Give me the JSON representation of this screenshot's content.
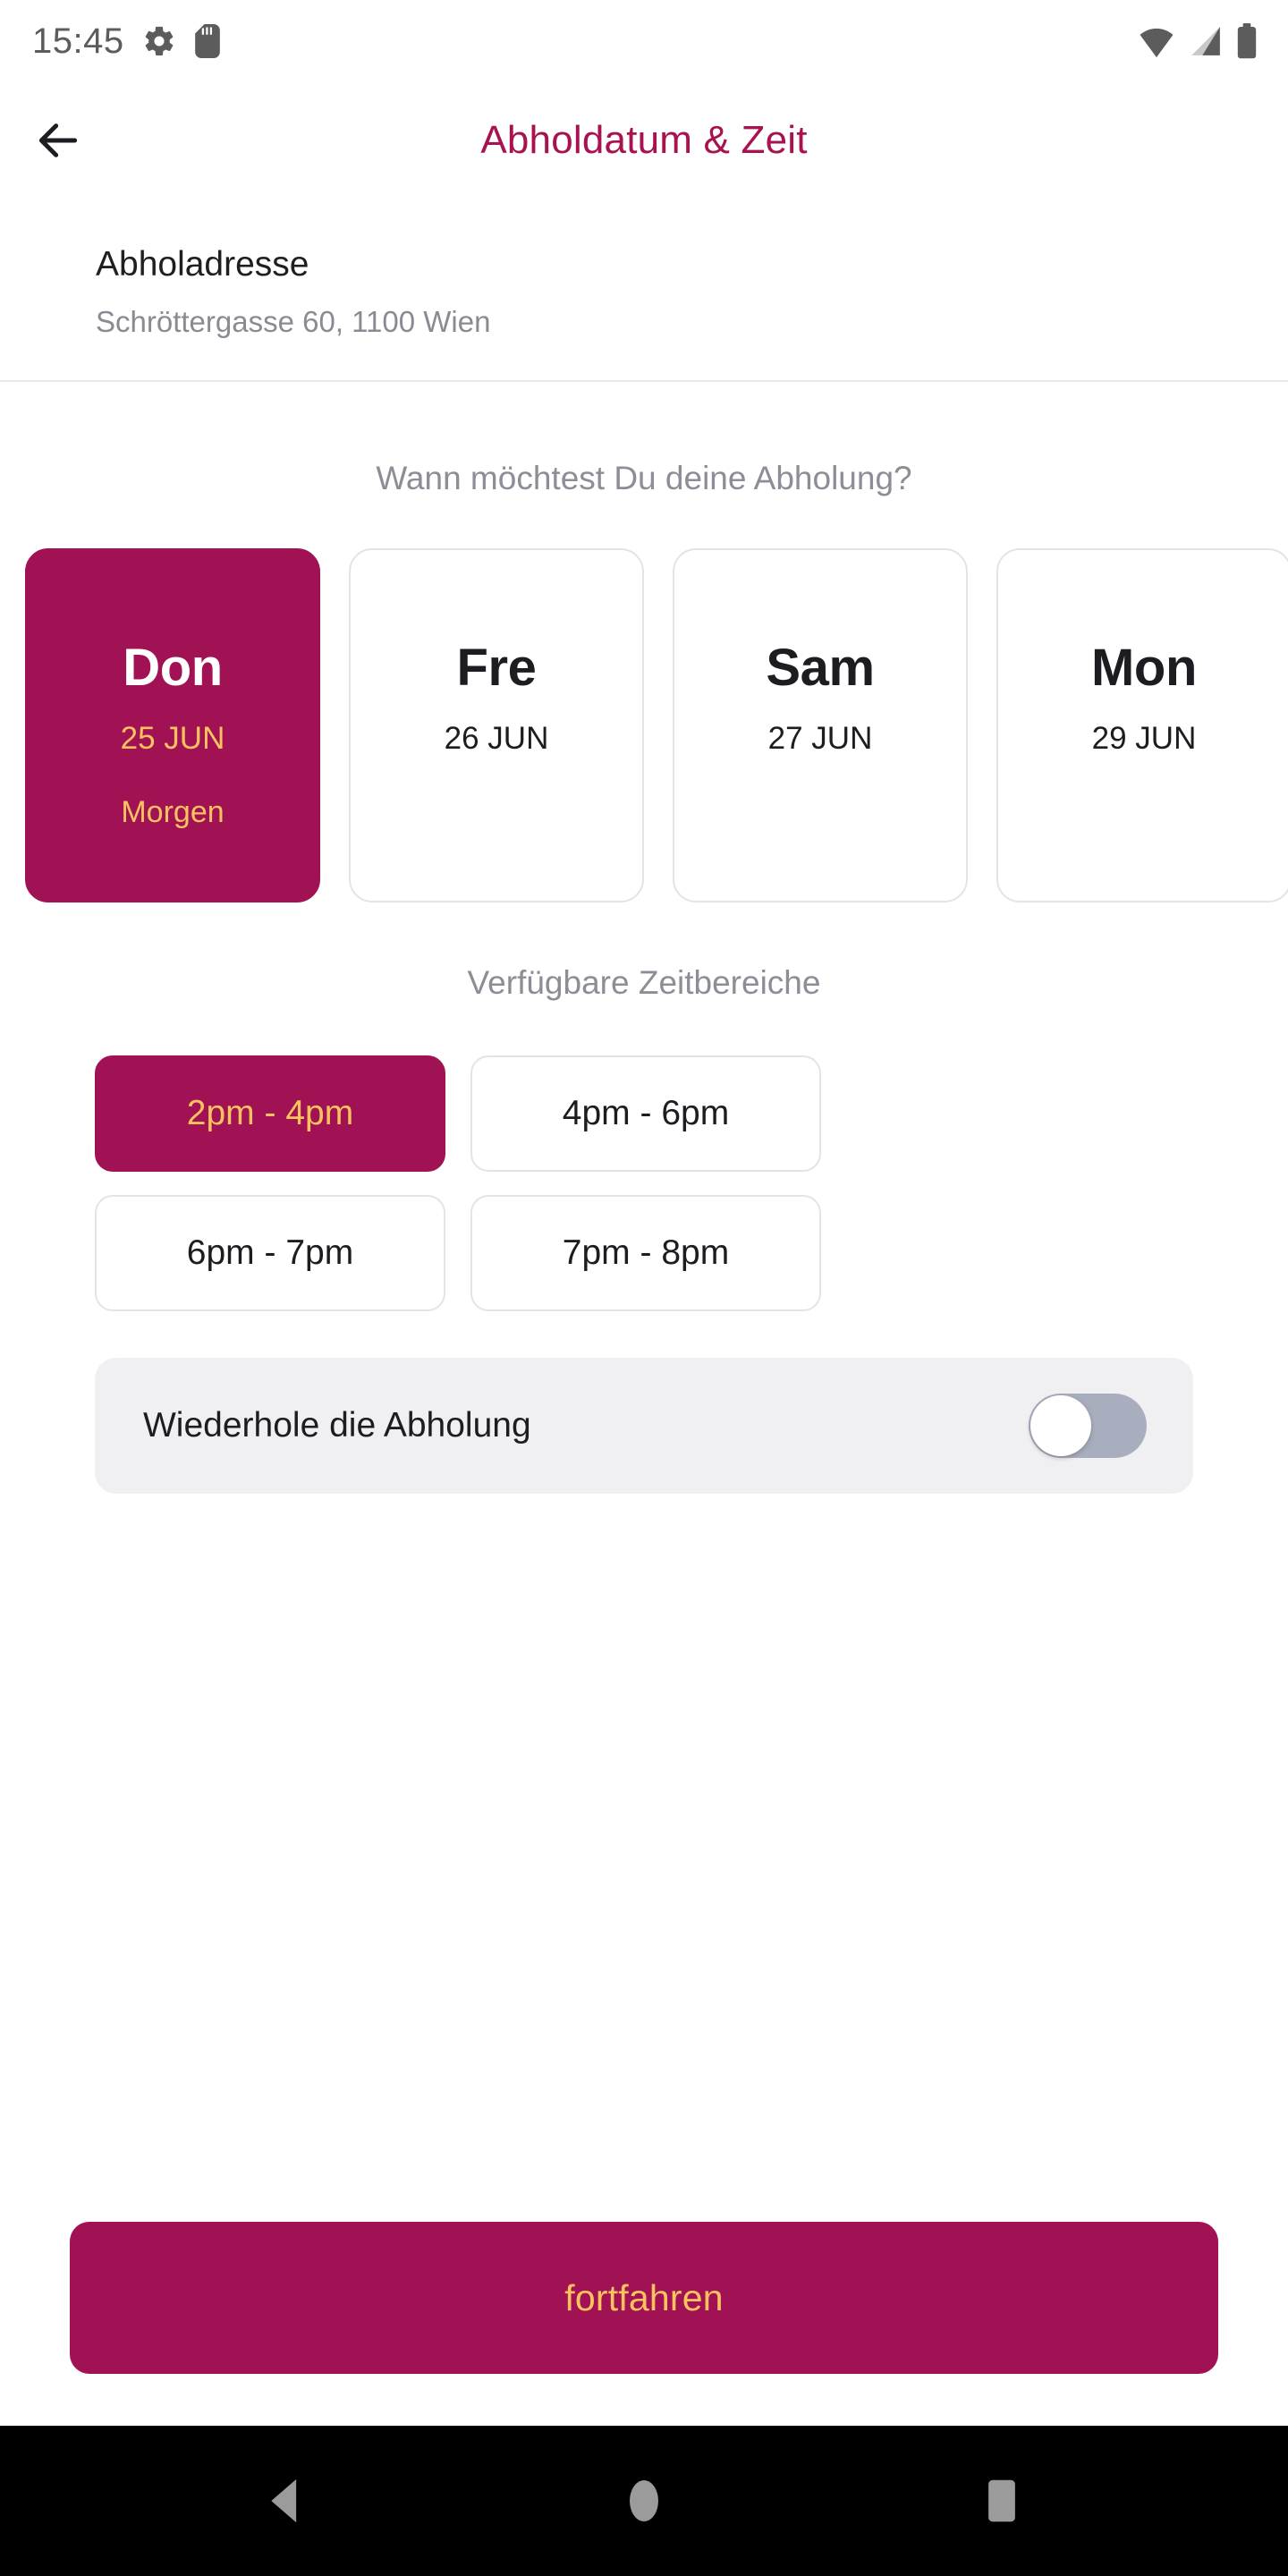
{
  "status_bar": {
    "clock": "15:45",
    "left_icons": [
      "gear-icon",
      "sd-card-icon"
    ],
    "right_icons": [
      "wifi-icon",
      "cellular-signal-icon",
      "battery-icon"
    ]
  },
  "header": {
    "title": "Abholdatum & Zeit",
    "back_icon": "arrow-left-icon"
  },
  "address": {
    "title": "Abholadresse",
    "value": "Schröttergasse 60, 1100 Wien"
  },
  "day_section": {
    "question": "Wann möchtest Du deine Abholung?",
    "days": [
      {
        "name": "Don",
        "date": "25 JUN",
        "note": "Morgen",
        "selected": true
      },
      {
        "name": "Fre",
        "date": "26 JUN",
        "note": "",
        "selected": false
      },
      {
        "name": "Sam",
        "date": "27 JUN",
        "note": "",
        "selected": false
      },
      {
        "name": "Mon",
        "date": "29 JUN",
        "note": "",
        "selected": false
      }
    ]
  },
  "time_section": {
    "label": "Verfügbare Zeitbereiche",
    "slots": [
      {
        "label": "2pm - 4pm",
        "selected": true
      },
      {
        "label": "4pm - 6pm",
        "selected": false
      },
      {
        "label": "6pm - 7pm",
        "selected": false
      },
      {
        "label": "7pm - 8pm",
        "selected": false
      }
    ]
  },
  "repeat_toggle": {
    "label": "Wiederhole die Abholung",
    "state": "off"
  },
  "cta": {
    "label": "fortfahren"
  },
  "nav_bar": {
    "buttons": [
      "back-triangle-icon",
      "home-circle-icon",
      "recents-square-icon"
    ]
  },
  "colors": {
    "brand_magenta": "#a01253",
    "title_magenta": "#a81250",
    "accent_gold": "#fbc25f",
    "muted_gray": "#8d8d98",
    "border_gray": "#e4e4e7",
    "toggle_track_off": "#a9aebe",
    "panel_gray": "#f0f0f2"
  }
}
